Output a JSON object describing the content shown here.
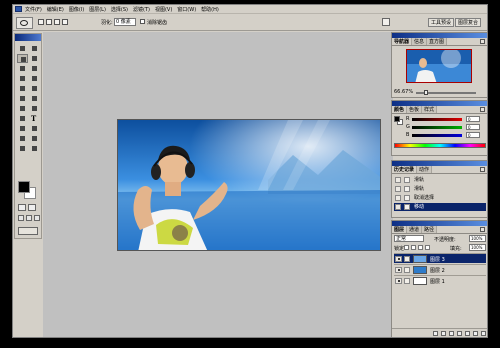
{
  "menu": {
    "items": [
      "文件(F)",
      "编辑(E)",
      "图像(I)",
      "图层(L)",
      "选择(S)",
      "滤镜(T)",
      "视图(V)",
      "窗口(W)",
      "帮助(H)"
    ]
  },
  "options": {
    "feather_label": "羽化:",
    "feather_value": "0 像素",
    "antialias_label": "消除锯齿",
    "right_tabs": [
      "工具预设",
      "图层复合"
    ]
  },
  "navigator": {
    "tabs": [
      "导航器",
      "信息",
      "直方图"
    ],
    "zoom": "66.67%"
  },
  "color": {
    "tabs": [
      "颜色",
      "色板",
      "样式"
    ],
    "channels": [
      {
        "label": "R",
        "value": "0",
        "gradient": "#e00000"
      },
      {
        "label": "G",
        "value": "0",
        "gradient": "#00b000"
      },
      {
        "label": "B",
        "value": "0",
        "gradient": "#0000d8"
      }
    ]
  },
  "history": {
    "tabs": [
      "历史记录",
      "动作"
    ],
    "items": [
      {
        "label": "滑轨",
        "active": false
      },
      {
        "label": "滑轨",
        "active": false
      },
      {
        "label": "取消选择",
        "active": false
      },
      {
        "label": "移动",
        "active": true
      }
    ]
  },
  "layers": {
    "tabs": [
      "图层",
      "通道",
      "路径"
    ],
    "blend_mode": "正常",
    "opacity_label": "不透明度:",
    "opacity": "100%",
    "lock_label": "锁定:",
    "fill_label": "填充:",
    "fill": "100%",
    "items": [
      {
        "name": "图层 3",
        "active": true,
        "thumb": "#6aa6e6"
      },
      {
        "name": "图层 2",
        "active": false,
        "thumb": "#2e7bc9"
      },
      {
        "name": "图层 1",
        "active": false,
        "thumb": "#ffffff"
      }
    ]
  },
  "toolbox": {
    "tools": [
      "marquee-icon",
      "move-icon",
      "lasso-icon",
      "magic-wand-icon",
      "crop-icon",
      "slice-icon",
      "healing-icon",
      "brush-icon",
      "stamp-icon",
      "history-brush-icon",
      "eraser-icon",
      "gradient-icon",
      "blur-icon",
      "dodge-icon",
      "path-select-icon",
      "type-icon",
      "pen-icon",
      "shape-icon",
      "notes-icon",
      "eyedropper-icon",
      "hand-icon",
      "zoom-icon"
    ]
  },
  "colors": {
    "app_bg": "#d4d0c8",
    "canvas_bg": "#c0c0c0",
    "accent": "#0a246a"
  }
}
